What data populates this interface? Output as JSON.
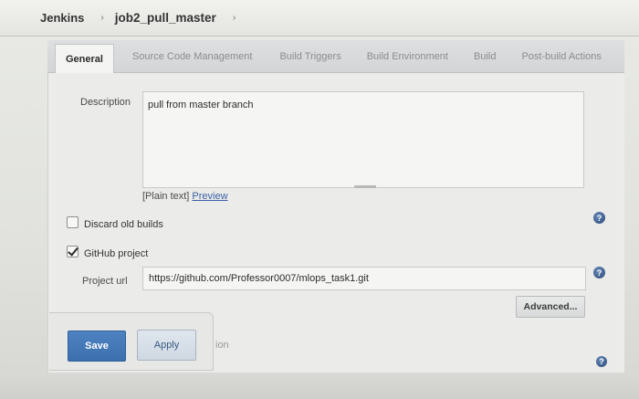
{
  "breadcrumb": {
    "root": "Jenkins",
    "job": "job2_pull_master",
    "sep1": "›",
    "sep2": "›"
  },
  "tabs": [
    {
      "label": "General",
      "active": true
    },
    {
      "label": "Source Code Management",
      "active": false
    },
    {
      "label": "Build Triggers",
      "active": false
    },
    {
      "label": "Build Environment",
      "active": false
    },
    {
      "label": "Build",
      "active": false
    },
    {
      "label": "Post-build Actions",
      "active": false
    }
  ],
  "general": {
    "description_label": "Description",
    "description_value": "pull from master branch",
    "plain_text": "[Plain text]",
    "preview_link": "Preview",
    "discard_old_builds": {
      "label": "Discard old builds",
      "checked": false
    },
    "github_project": {
      "label": "GitHub project",
      "checked": true
    },
    "project_url_label": "Project url",
    "project_url_value": "https://github.com/Professor0007/mlops_task1.git",
    "advanced_label": "Advanced..."
  },
  "actions": {
    "save_label": "Save",
    "apply_label": "Apply",
    "truncated_text": "ion"
  },
  "icons": {
    "help_glyph": "?",
    "help_color": "#3a5a8c"
  },
  "colors": {
    "accent_save": "#3c6fae",
    "link": "#3b5fa6"
  }
}
